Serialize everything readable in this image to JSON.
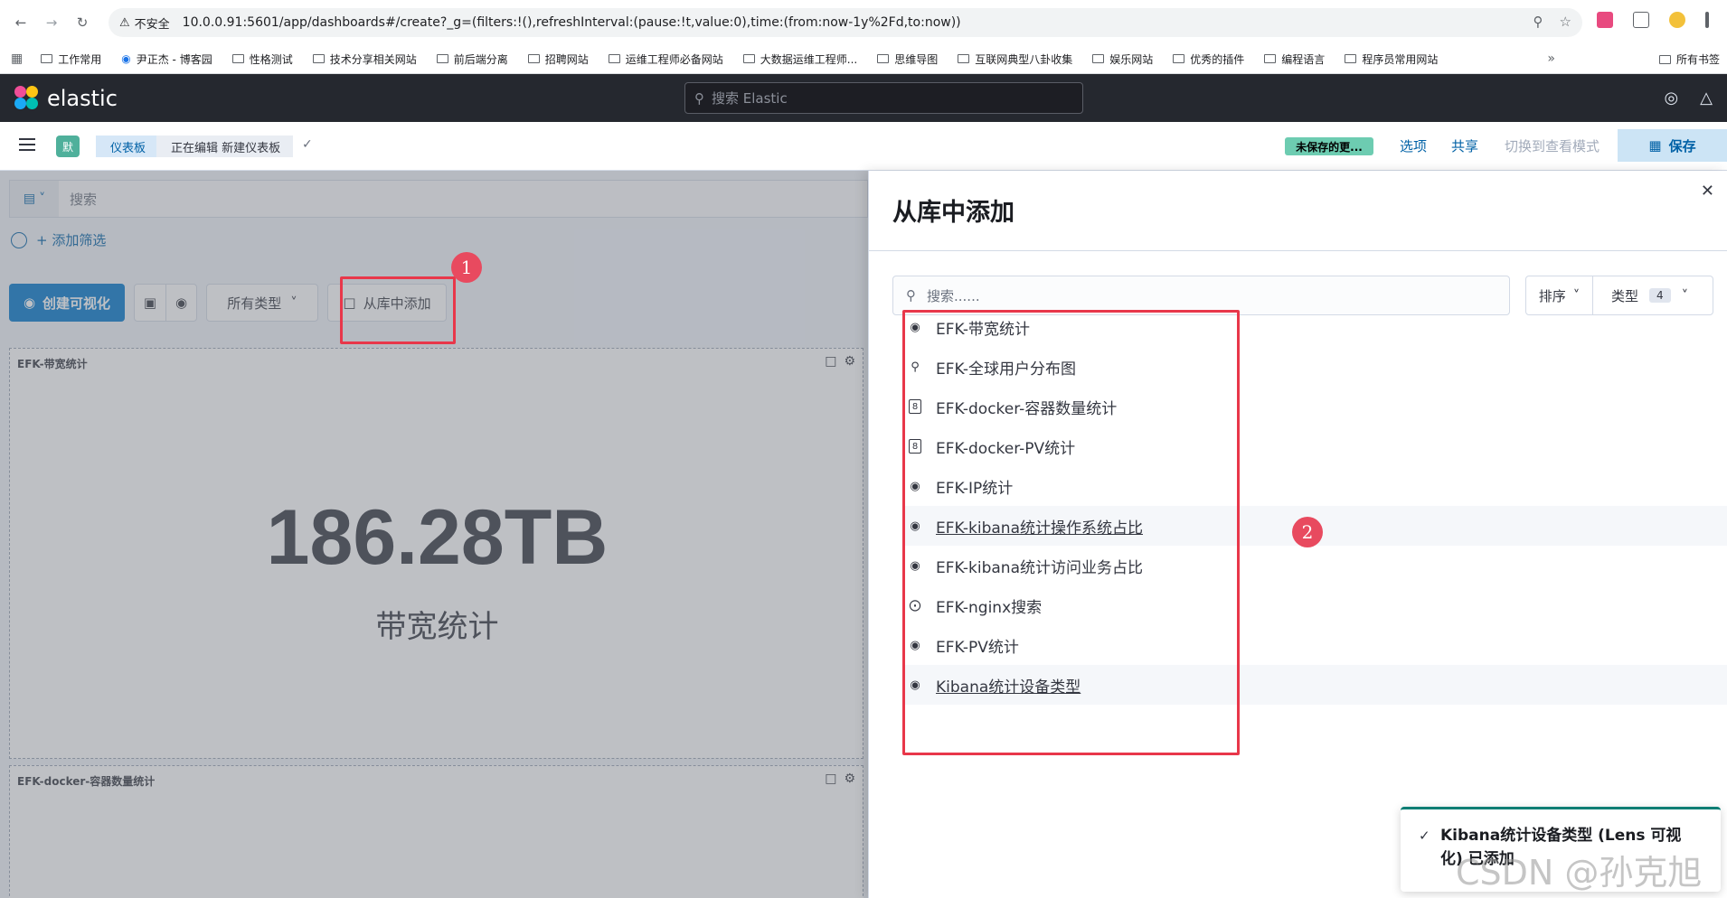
{
  "browser": {
    "security_label": "不安全",
    "url": "10.0.0.91:5601/app/dashboards#/create?_g=(filters:!(),refreshInterval:(pause:!t,value:0),time:(from:now-1y%2Fd,to:now))",
    "bookmarks": [
      "工作常用",
      "尹正杰 - 博客园",
      "性格测试",
      "技术分享相关网站",
      "前后端分离",
      "招聘网站",
      "运维工程师必备网站",
      "大数据运维工程师...",
      "思维导图",
      "互联网典型八卦收集",
      "娱乐网站",
      "优秀的插件",
      "编程语言",
      "程序员常用网站"
    ],
    "bookmarks_more": "»",
    "bookmarks_other": "所有书签"
  },
  "kibana": {
    "brand": "elastic",
    "search_placeholder": "搜索 Elastic"
  },
  "breadcrumb": {
    "space_initial": "默",
    "crumb_dashboards": "仪表板",
    "crumb_current": "正在编辑 新建仪表板"
  },
  "top_actions": {
    "unsaved_badge": "未保存的更...",
    "options": "选项",
    "share": "共享",
    "switch_view": "切换到查看模式",
    "save": "保存"
  },
  "dashboard": {
    "query_placeholder": "搜索",
    "add_filter": "+ 添加筛选",
    "create_visualization": "创建可视化",
    "all_types": "所有类型",
    "add_from_library": "从库中添加",
    "panels": [
      {
        "title": "EFK-带宽统计",
        "metric_value": "186.28TB",
        "metric_label": "带宽统计"
      },
      {
        "title": "EFK-docker-容器数量统计"
      }
    ]
  },
  "annotations": {
    "step1": "1",
    "step2": "2"
  },
  "flyout": {
    "title": "从库中添加",
    "search_placeholder": "搜索......",
    "sort_label": "排序",
    "type_label": "类型",
    "type_count": "4",
    "items": [
      {
        "label": "EFK-带宽统计",
        "icon": "lens-icon"
      },
      {
        "label": "EFK-全球用户分布图",
        "icon": "map-icon"
      },
      {
        "label": "EFK-docker-容器数量统计",
        "icon": "tsvb-icon"
      },
      {
        "label": "EFK-docker-PV统计",
        "icon": "tsvb-icon"
      },
      {
        "label": "EFK-IP统计",
        "icon": "lens-icon"
      },
      {
        "label": "EFK-kibana统计操作系统占比",
        "icon": "lens-icon"
      },
      {
        "label": "EFK-kibana统计访问业务占比",
        "icon": "lens-icon"
      },
      {
        "label": "EFK-nginx搜索",
        "icon": "discover-icon"
      },
      {
        "label": "EFK-PV统计",
        "icon": "lens-icon"
      },
      {
        "label": "Kibana统计设备类型",
        "icon": "lens-icon"
      }
    ]
  },
  "toast": {
    "message": "Kibana统计设备类型 (Lens 可视化) 已添加"
  },
  "watermark": "CSDN @孙克旭"
}
